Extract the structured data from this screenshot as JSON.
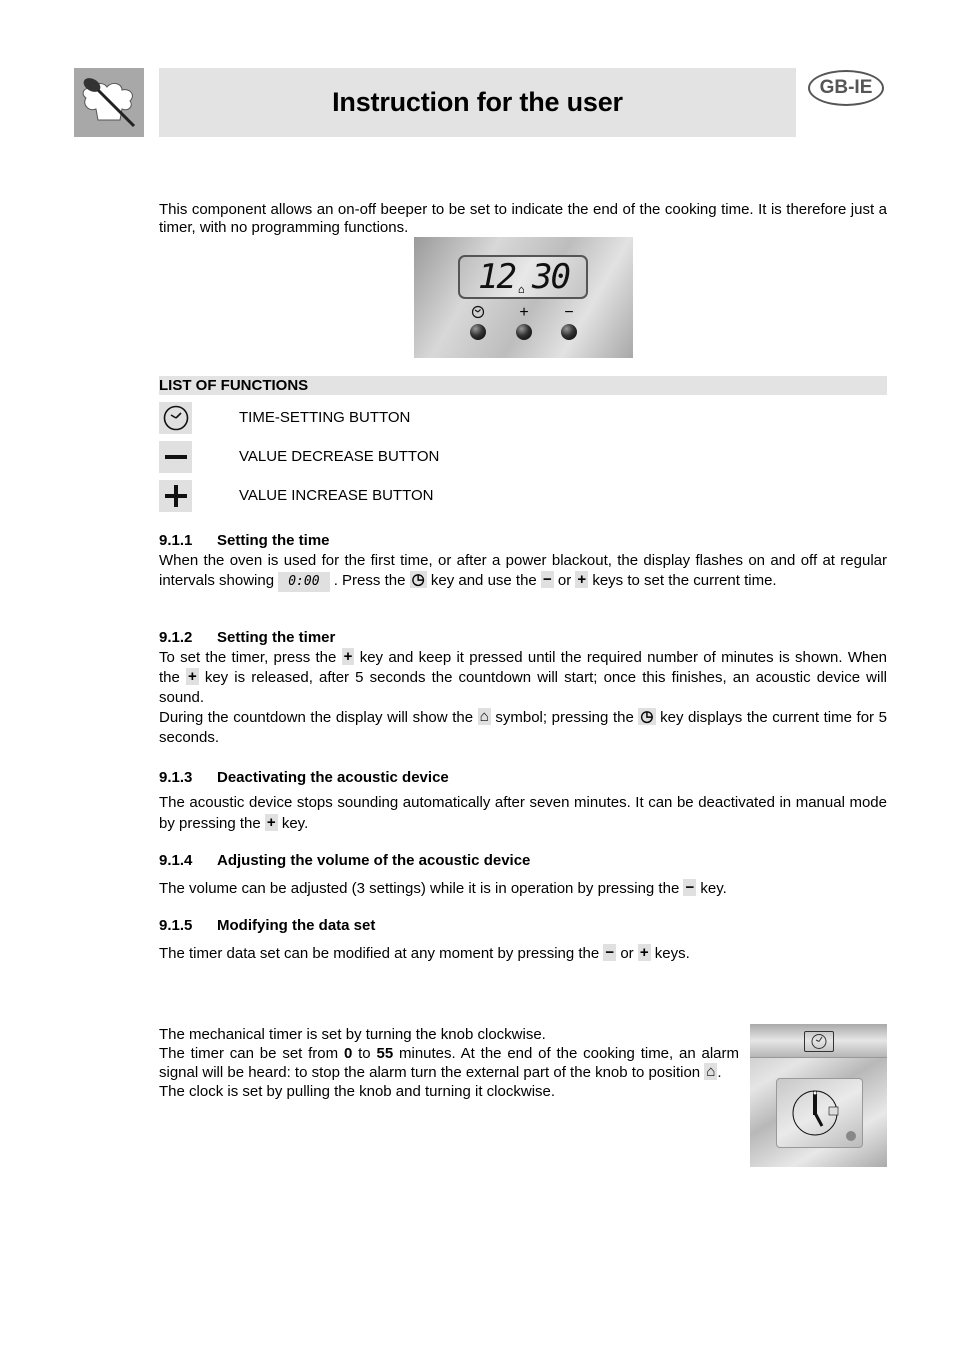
{
  "header": {
    "logo": "chef-hat-spoon-logo",
    "title": "Instruction for the user",
    "language_badge": "GB-IE"
  },
  "intro": {
    "text": "This component allows an on-off beeper to be set to indicate the end of the cooking time.  It is therefore just a timer, with no programming functions."
  },
  "panel": {
    "display_hours": "12",
    "display_minutes": "30",
    "display_symbol": "bell-icon",
    "buttons": [
      {
        "label": "clock-icon"
      },
      {
        "label": "+"
      },
      {
        "label": "−"
      }
    ]
  },
  "functions": {
    "header": "LIST OF FUNCTIONS",
    "items": [
      {
        "icon": "clock-icon",
        "label": "TIME-SETTING BUTTON"
      },
      {
        "icon": "minus-icon",
        "label": "VALUE DECREASE BUTTON"
      },
      {
        "icon": "plus-icon",
        "label": "VALUE INCREASE BUTTON"
      }
    ]
  },
  "sections": {
    "s1": {
      "num": "9.1.1",
      "title": "Setting the time",
      "t1": "When the oven is used for the first time, or after a power blackout, the display flashes on and off at regular intervals showing",
      "display": "0:00",
      "t2": ". Press the",
      "t3": "key and use the",
      "t4": "or",
      "t5": "keys to set the current time."
    },
    "s2": {
      "num": "9.1.2",
      "title": "Setting the timer",
      "t1": "To set the timer, press the",
      "t2": "key and keep it pressed until the required number of minutes is shown.",
      "t3": "When the",
      "t4": "key is released, after 5 seconds the countdown will start; once this finishes, an acoustic device will sound.",
      "t5": "During the countdown the display will show the",
      "t6": "symbol; pressing the",
      "t7": "key displays the current time for 5 seconds."
    },
    "s3": {
      "num": "9.1.3",
      "title": "Deactivating the acoustic device",
      "t1": "The acoustic device stops sounding automatically after seven minutes.  It can be deactivated in manual mode by pressing the",
      "t2": "key."
    },
    "s4": {
      "num": "9.1.4",
      "title": "Adjusting the volume of the acoustic device",
      "t1": "The volume can be adjusted (3 settings) while it is in operation by pressing the",
      "t2": "key."
    },
    "s5": {
      "num": "9.1.5",
      "title": "Modifying the data set",
      "t1": "The timer data set can be modified at any moment by pressing the",
      "t2": "or",
      "t3": "keys."
    }
  },
  "mechanical": {
    "line1": "The mechanical timer is set by turning the knob clockwise.",
    "line2a": "The timer can be set from",
    "min": "0",
    "to": "to",
    "max": "55",
    "line2b": "minutes. At the end of the cooking time, an alarm signal will be heard: to stop the alarm turn the external part of the knob to position",
    "line2c": ".",
    "line3": "The clock is set by pulling the knob and turning it clockwise."
  },
  "glyphs": {
    "plus": "+",
    "minus": "−"
  }
}
